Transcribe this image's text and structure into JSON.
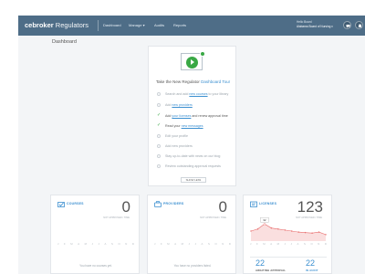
{
  "header": {
    "brand_main": "cebroker",
    "brand_sub": "Regulators",
    "nav": [
      "Dashboard",
      "Manage",
      "Audits",
      "Reports"
    ],
    "account_label": "Hello Board",
    "account_name": "Alabama Board of Nursing",
    "icons": [
      "chat-icon",
      "bell-icon",
      "avatar"
    ],
    "brand_color": "#4e6d87",
    "accent_color": "#3b8fd0",
    "success_color": "#39a845"
  },
  "page_title": "Dashboard",
  "tour": {
    "title_prefix": "Take the New Regulator",
    "title_link": "Dashboard Tour",
    "tasks": [
      {
        "pre": "Search and add ",
        "link": "new courses",
        "post": " to your library",
        "done": false
      },
      {
        "pre": "Add ",
        "link": "new providers",
        "post": "",
        "done": false
      },
      {
        "pre": "Add ",
        "link": "your licenses",
        "post": " and renew approval time",
        "done": true
      },
      {
        "pre": "Read your ",
        "link": "new messages",
        "post": "",
        "done": true
      },
      {
        "pre": "Edit your profile",
        "link": "",
        "post": "",
        "done": false
      },
      {
        "pre": "Add new providers",
        "link": "",
        "post": "",
        "done": false
      },
      {
        "pre": "Stay up-to-date with news on our blog",
        "link": "",
        "post": "",
        "done": false
      },
      {
        "pre": "Review outstanding approval requests",
        "link": "",
        "post": "",
        "done": false
      }
    ],
    "show_less": "SHOW LESS"
  },
  "cards": {
    "courses": {
      "label": "COURSES",
      "count": "0",
      "sub": "NOT APPROVED / TIME",
      "footer": "You have no courses yet."
    },
    "providers": {
      "label": "PROVIDERS",
      "count": "0",
      "sub": "NOT APPROVED / TIME",
      "footer": "You have no providers listed."
    },
    "licenses": {
      "label": "LICENSES",
      "count": "123",
      "sub": "NOT APPROVED / TIME",
      "tooltip": "32",
      "left_num": "22",
      "left_label": "AWAITING APPROVAL",
      "right_num": "22",
      "right_label": "IN AUDIT"
    }
  },
  "months": [
    "J",
    "F",
    "M",
    "A",
    "M",
    "J",
    "J",
    "A",
    "S",
    "O",
    "N",
    "D"
  ],
  "chart_data": {
    "type": "area",
    "categories": [
      "J",
      "F",
      "M",
      "A",
      "M",
      "J",
      "J",
      "A",
      "S",
      "O",
      "N",
      "D"
    ],
    "series": [
      {
        "values": [
          18,
          22,
          32,
          24,
          22,
          20,
          18,
          16,
          15,
          14,
          16,
          11
        ]
      }
    ],
    "ylim": [
      0,
      36
    ],
    "color": "#e86a6a"
  }
}
